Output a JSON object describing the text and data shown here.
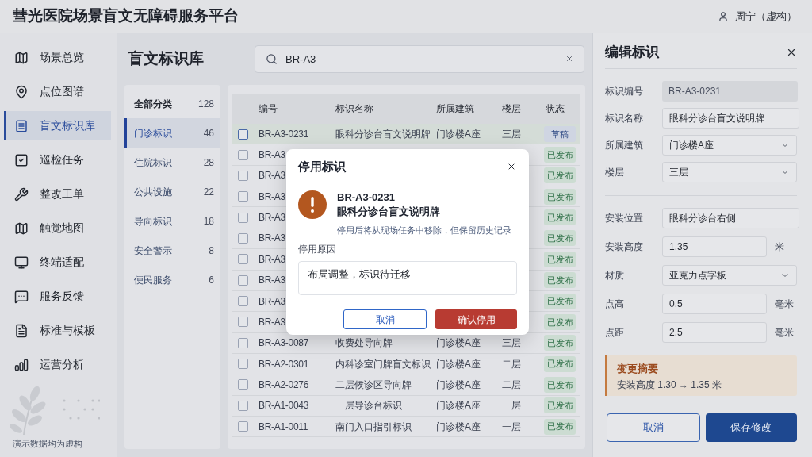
{
  "header": {
    "title": "彗光医院场景盲文无障碍服务平台",
    "user": "周宁（虚构）"
  },
  "nav": {
    "items": [
      {
        "label": "场景总览",
        "selected": false
      },
      {
        "label": "点位图谱",
        "selected": false
      },
      {
        "label": "盲文标识库",
        "selected": true
      },
      {
        "label": "巡检任务",
        "selected": false
      },
      {
        "label": "整改工单",
        "selected": false
      },
      {
        "label": "触觉地图",
        "selected": false
      },
      {
        "label": "终端适配",
        "selected": false
      },
      {
        "label": "服务反馈",
        "selected": false
      },
      {
        "label": "标准与模板",
        "selected": false
      },
      {
        "label": "运营分析",
        "selected": false
      }
    ],
    "footer_note": "演示数据均为虚构"
  },
  "page": {
    "title": "盲文标识库",
    "search": {
      "value": "BR-A3"
    }
  },
  "categories": [
    {
      "label": "全部分类",
      "count": "128",
      "kind": "total",
      "selected": false
    },
    {
      "label": "门诊标识",
      "count": "46",
      "kind": "category",
      "selected": true
    },
    {
      "label": "住院标识",
      "count": "28",
      "kind": "category",
      "selected": false
    },
    {
      "label": "公共设施",
      "count": "22",
      "kind": "category",
      "selected": false
    },
    {
      "label": "导向标识",
      "count": "18",
      "kind": "category",
      "selected": false
    },
    {
      "label": "安全警示",
      "count": "8",
      "kind": "category",
      "selected": false
    },
    {
      "label": "便民服务",
      "count": "6",
      "kind": "category",
      "selected": false
    }
  ],
  "table": {
    "columns": [
      "编号",
      "标识名称",
      "所属建筑",
      "楼层",
      "状态"
    ],
    "rows": [
      {
        "id": "BR-A3-0231",
        "name": "眼科分诊台盲文说明牌",
        "building": "门诊楼A座",
        "floor": "三层",
        "status": {
          "label": "草稿",
          "kind": "draft"
        },
        "selected": true,
        "checked": false
      },
      {
        "id": "BR-A3",
        "status": {
          "label": "已发布",
          "kind": "published"
        },
        "selected": false,
        "checked": false
      },
      {
        "id": "BR-A3",
        "status": {
          "label": "已发布",
          "kind": "published"
        },
        "selected": false,
        "checked": false
      },
      {
        "id": "BR-A3",
        "status": {
          "label": "已发布",
          "kind": "published"
        },
        "selected": false,
        "checked": false
      },
      {
        "id": "BR-A3",
        "status": {
          "label": "已发布",
          "kind": "published"
        },
        "selected": false,
        "checked": false
      },
      {
        "id": "BR-A3",
        "status": {
          "label": "已发布",
          "kind": "published"
        },
        "selected": false,
        "checked": false
      },
      {
        "id": "BR-A3",
        "status": {
          "label": "已发布",
          "kind": "published"
        },
        "selected": false,
        "checked": false
      },
      {
        "id": "BR-A3",
        "status": {
          "label": "已发布",
          "kind": "published"
        },
        "selected": false,
        "checked": false
      },
      {
        "id": "BR-A3",
        "status": {
          "label": "已发布",
          "kind": "published"
        },
        "selected": false,
        "checked": false
      },
      {
        "id": "BR-A3",
        "status": {
          "label": "已发布",
          "kind": "published"
        },
        "selected": false,
        "checked": false
      },
      {
        "id": "BR-A3-0087",
        "name": "收费处导向牌",
        "building": "门诊楼A座",
        "floor": "三层",
        "status": {
          "label": "已发布",
          "kind": "published"
        },
        "selected": false,
        "checked": false
      },
      {
        "id": "BR-A2-0301",
        "name": "内科诊室门牌盲文标识",
        "building": "门诊楼A座",
        "floor": "二层",
        "status": {
          "label": "已发布",
          "kind": "published"
        },
        "selected": false,
        "checked": false
      },
      {
        "id": "BR-A2-0276",
        "name": "二层候诊区导向牌",
        "building": "门诊楼A座",
        "floor": "二层",
        "status": {
          "label": "已发布",
          "kind": "published"
        },
        "selected": false,
        "checked": false
      },
      {
        "id": "BR-A1-0043",
        "name": "一层导诊台标识",
        "building": "门诊楼A座",
        "floor": "一层",
        "status": {
          "label": "已发布",
          "kind": "published"
        },
        "selected": false,
        "checked": false
      },
      {
        "id": "BR-A1-0011",
        "name": "南门入口指引标识",
        "building": "门诊楼A座",
        "floor": "一层",
        "status": {
          "label": "已发布",
          "kind": "published"
        },
        "selected": false,
        "checked": false
      }
    ]
  },
  "editor": {
    "title": "编辑标识",
    "sections": [
      [
        {
          "label": "标识编号",
          "value": "BR-A3-0231",
          "kind": "readonly"
        },
        {
          "label": "标识名称",
          "value": "眼科分诊台盲文说明牌",
          "kind": "text"
        },
        {
          "label": "所属建筑",
          "value": "门诊楼A座",
          "kind": "select"
        },
        {
          "label": "楼层",
          "value": "三层",
          "kind": "select"
        }
      ],
      [
        {
          "label": "安装位置",
          "value": "眼科分诊台右侧",
          "kind": "text"
        },
        {
          "label": "安装高度",
          "value": "1.35",
          "kind": "text",
          "unit": "米"
        },
        {
          "label": "材质",
          "value": "亚克力点字板",
          "kind": "select"
        },
        {
          "label": "点高",
          "value": "0.5",
          "kind": "text",
          "unit": "毫米"
        },
        {
          "label": "点距",
          "value": "2.5",
          "kind": "text",
          "unit": "毫米"
        }
      ]
    ],
    "summary": {
      "title": "变更摘要",
      "text": "安装高度 1.30 → 1.35 米"
    },
    "buttons": [
      {
        "label": "取消",
        "kind": "secondary"
      },
      {
        "label": "保存修改",
        "kind": "primary"
      }
    ]
  },
  "dialog": {
    "title": "停用标识",
    "item_id": "BR-A3-0231",
    "item_name": "眼科分诊台盲文说明牌",
    "note": "停用后将从现场任务中移除，但保留历史记录",
    "reason_label": "停用原因",
    "reason": "布局调整，标识待迁移",
    "buttons": [
      {
        "label": "取消",
        "kind": "secondary"
      },
      {
        "label": "确认停用",
        "kind": "danger"
      }
    ]
  }
}
